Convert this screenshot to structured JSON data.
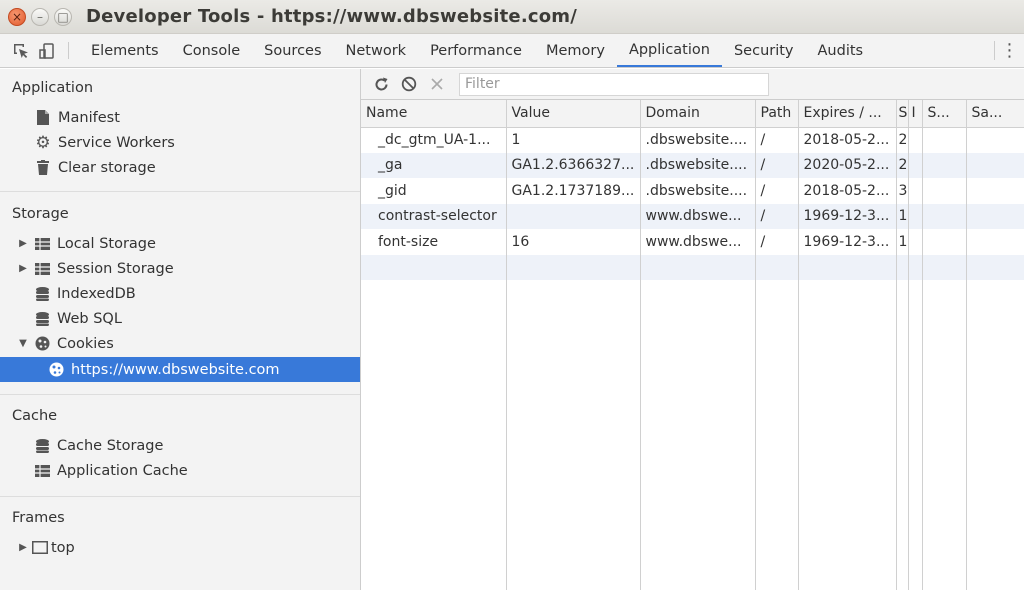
{
  "window": {
    "title": "Developer Tools - https://www.dbswebsite.com/",
    "buttons": {
      "close": "×",
      "minimize": "–",
      "maximize": "□"
    }
  },
  "toolbar": {
    "tabs": [
      {
        "label": "Elements"
      },
      {
        "label": "Console"
      },
      {
        "label": "Sources"
      },
      {
        "label": "Network"
      },
      {
        "label": "Performance"
      },
      {
        "label": "Memory"
      },
      {
        "label": "Application",
        "active": true
      },
      {
        "label": "Security"
      },
      {
        "label": "Audits"
      }
    ],
    "more_glyph": "⋮"
  },
  "sidebar": {
    "application": {
      "title": "Application",
      "items": [
        {
          "label": "Manifest",
          "icon": "document-icon"
        },
        {
          "label": "Service Workers",
          "icon": "gear-icon"
        },
        {
          "label": "Clear storage",
          "icon": "trash-icon"
        }
      ]
    },
    "storage": {
      "title": "Storage",
      "items": [
        {
          "label": "Local Storage",
          "icon": "grid-icon"
        },
        {
          "label": "Session Storage",
          "icon": "grid-icon"
        },
        {
          "label": "IndexedDB",
          "icon": "database-icon"
        },
        {
          "label": "Web SQL",
          "icon": "database-icon"
        },
        {
          "label": "Cookies",
          "icon": "cookie-icon"
        },
        {
          "label": "https://www.dbswebsite.com",
          "icon": "cookie-icon"
        }
      ]
    },
    "cache": {
      "title": "Cache",
      "items": [
        {
          "label": "Cache Storage",
          "icon": "database-icon"
        },
        {
          "label": "Application Cache",
          "icon": "grid-icon"
        }
      ]
    },
    "frames": {
      "title": "Frames",
      "items": [
        {
          "label": "top",
          "icon": "frame-icon"
        }
      ]
    },
    "selected_color": "#3879d9"
  },
  "content": {
    "filter": {
      "placeholder": "Filter",
      "value": ""
    },
    "columns": [
      "Name",
      "Value",
      "Domain",
      "Path",
      "Expires / ...",
      "S",
      "I",
      "S...",
      "Sa..."
    ],
    "rows": [
      [
        "_dc_gtm_UA-1...",
        "1",
        ".dbswebsite....",
        "/",
        "2018-05-2...",
        "2",
        "",
        "",
        ""
      ],
      [
        "_ga",
        "GA1.2.6366327...",
        ".dbswebsite....",
        "/",
        "2020-05-2...",
        "2",
        "",
        "",
        ""
      ],
      [
        "_gid",
        "GA1.2.1737189...",
        ".dbswebsite....",
        "/",
        "2018-05-2...",
        "3",
        "",
        "",
        ""
      ],
      [
        "contrast-selector",
        "",
        "www.dbswe...",
        "/",
        "1969-12-3...",
        "1",
        "",
        "",
        ""
      ],
      [
        "font-size",
        "16",
        "www.dbswe...",
        "/",
        "1969-12-3...",
        "1",
        "",
        "",
        ""
      ]
    ]
  }
}
